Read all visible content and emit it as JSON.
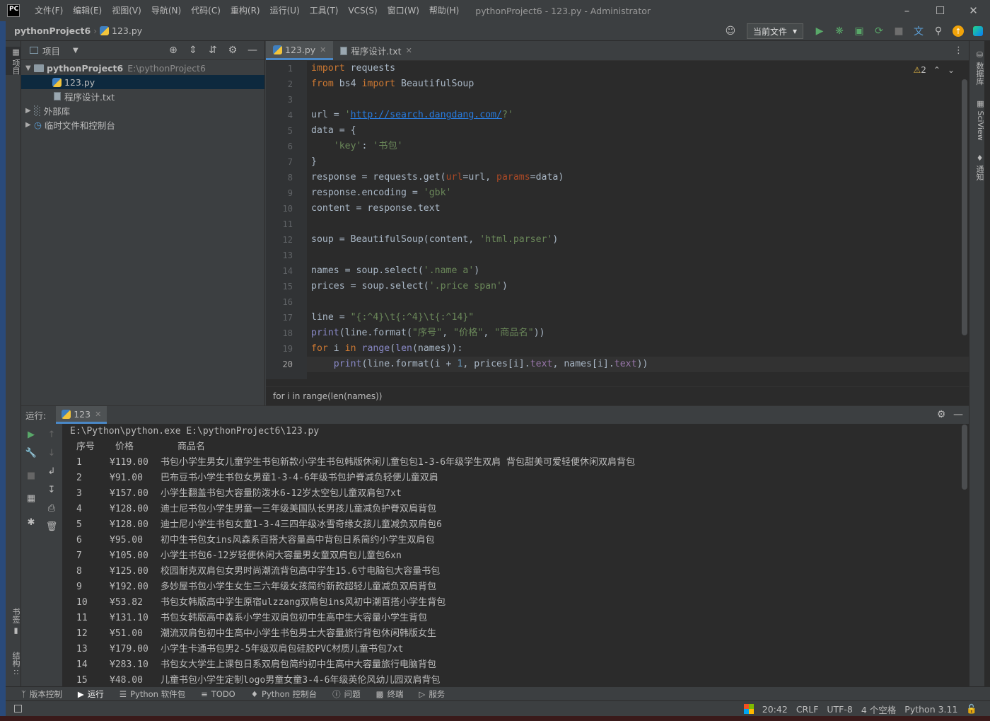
{
  "titlebar": {
    "logo": "PC",
    "menus": [
      "文件(F)",
      "编辑(E)",
      "视图(V)",
      "导航(N)",
      "代码(C)",
      "重构(R)",
      "运行(U)",
      "工具(T)",
      "VCS(S)",
      "窗口(W)",
      "帮助(H)"
    ],
    "title": "pythonProject6 - 123.py - Administrator"
  },
  "navbar": {
    "project": "pythonProject6",
    "file": "123.py",
    "run_config": "当前文件"
  },
  "left_stripe": {
    "project_tab": "项目",
    "bookmarks_tab": "书签",
    "structure_tab": "结构"
  },
  "right_stripe": {
    "database_tab": "数据库",
    "sciview_tab": "SciView",
    "notifications_tab": "通知"
  },
  "project_panel": {
    "title": "项目",
    "tree": [
      {
        "label": "pythonProject6",
        "path": "E:\\pythonProject6"
      },
      {
        "label": "123.py"
      },
      {
        "label": "程序设计.txt"
      },
      {
        "label": "外部库"
      },
      {
        "label": "临时文件和控制台"
      }
    ]
  },
  "editor": {
    "tabs": [
      {
        "label": "123.py"
      },
      {
        "label": "程序设计.txt"
      }
    ],
    "warnings": "2",
    "line_numbers": [
      "1",
      "2",
      "3",
      "4",
      "5",
      "6",
      "7",
      "8",
      "9",
      "10",
      "11",
      "12",
      "13",
      "14",
      "15",
      "16",
      "17",
      "18",
      "19",
      "20"
    ],
    "current_line": 20,
    "breadcrumb": "for i in range(len(names))"
  },
  "run_panel": {
    "label": "运行:",
    "tab": "123",
    "command": "E:\\Python\\python.exe E:\\pythonProject6\\123.py",
    "header": {
      "num": "序号",
      "price": "价格",
      "name": "商品名"
    },
    "rows": [
      {
        "num": "1",
        "price": "¥119.00",
        "name": "书包小学生男女儿童学生书包新款小学生书包韩版休闲儿童包包1-3-6年级学生双肩 背包甜美可爱轻便休闲双肩背包"
      },
      {
        "num": "2",
        "price": "¥91.00",
        "name": "巴布豆书小学生书包女男童1-3-4-6年级书包护脊减负轻便儿童双肩"
      },
      {
        "num": "3",
        "price": "¥157.00",
        "name": "小学生翻盖书包大容量防泼水6-12岁太空包儿童双肩包7xt"
      },
      {
        "num": "4",
        "price": "¥128.00",
        "name": "迪士尼书包小学生男童一三年级美国队长男孩儿童减负护脊双肩背包"
      },
      {
        "num": "5",
        "price": "¥128.00",
        "name": "迪士尼小学生书包女童1-3-4三四年级冰雪奇缘女孩儿童减负双肩包6"
      },
      {
        "num": "6",
        "price": "¥95.00",
        "name": "初中生书包女ins风森系百搭大容量高中背包日系简约小学生双肩包"
      },
      {
        "num": "7",
        "price": "¥105.00",
        "name": "小学生书包6-12岁轻便休闲大容量男女童双肩包儿童包6xn"
      },
      {
        "num": "8",
        "price": "¥125.00",
        "name": "校园耐克双肩包女男时尚潮流背包高中学生15.6寸电脑包大容量书包"
      },
      {
        "num": "9",
        "price": "¥192.00",
        "name": "多妙屋书包小学生女生三六年级女孩简约新款超轻儿童减负双肩背包"
      },
      {
        "num": "10",
        "price": "¥53.82",
        "name": "书包女韩版高中学生原宿ulzzang双肩包ins风初中潮百搭小学生背包"
      },
      {
        "num": "11",
        "price": "¥131.10",
        "name": "书包女韩版高中森系小学生双肩包初中生高中生大容量小学生背包"
      },
      {
        "num": "12",
        "price": "¥51.00",
        "name": "潮流双肩包初中生高中小学生书包男士大容量旅行背包休闲韩版女生"
      },
      {
        "num": "13",
        "price": "¥179.00",
        "name": "小学生卡通书包男2-5年级双肩包硅胶PVC材质儿童书包7xt"
      },
      {
        "num": "14",
        "price": "¥283.10",
        "name": "书包女大学生上课包日系双肩包简约初中生高中大容量旅行电脑背包"
      },
      {
        "num": "15",
        "price": "¥48.00",
        "name": "儿童书包小学生定制logo男童女童3-4-6年级英伦风幼儿园双肩背包"
      }
    ]
  },
  "bottom_tabs": [
    "版本控制",
    "运行",
    "Python 软件包",
    "TODO",
    "Python 控制台",
    "问题",
    "终端",
    "服务"
  ],
  "statusbar": {
    "cursor": "20:42",
    "line_sep": "CRLF",
    "encoding": "UTF-8",
    "indent": "4 个空格",
    "interpreter": "Python 3.11"
  },
  "colors": {
    "accent": "#4a88c7",
    "keyword": "#cc7832",
    "string": "#6a8759",
    "builtin": "#8888c6",
    "number": "#6897bb",
    "param": "#aa4926"
  }
}
